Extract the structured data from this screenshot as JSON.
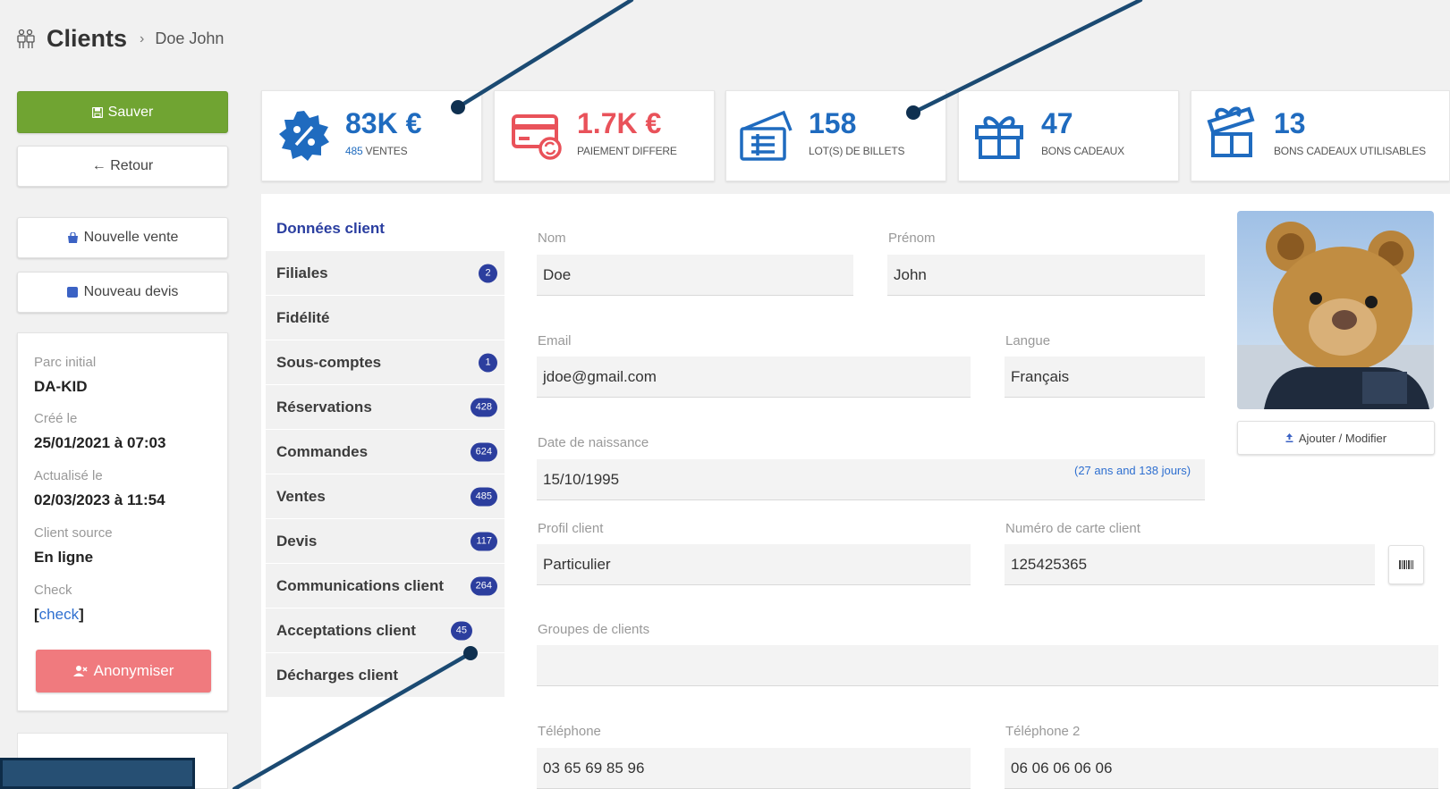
{
  "header": {
    "title": "Clients",
    "breadcrumb": "Doe John"
  },
  "actions": {
    "save": "Sauver",
    "back": "← Retour",
    "new_sale": "Nouvelle vente",
    "new_quote": "Nouveau devis",
    "anonymize": "Anonymiser"
  },
  "client_info": {
    "park_label": "Parc initial",
    "park_value": "DA-KID",
    "created_label": "Créé le",
    "created_value": "25/01/2021 à 07:03",
    "updated_label": "Actualisé le",
    "updated_value": "02/03/2023 à 11:54",
    "source_label": "Client source",
    "source_value": "En ligne",
    "check_label": "Check",
    "check_open": "[",
    "check_link": "check",
    "check_close": "]"
  },
  "stats": [
    {
      "value": "83K €",
      "label_count": "485",
      "label": " VENTES",
      "color": "#1f6bbf",
      "icon": "percent-badge-icon"
    },
    {
      "value": "1.7K €",
      "label": "PAIEMENT DIFFERE",
      "color": "#e9525a",
      "icon": "credit-card-sync-icon"
    },
    {
      "value": "158",
      "label": "LOT(S) DE BILLETS",
      "color": "#1f6bbf",
      "icon": "tickets-icon"
    },
    {
      "value": "47",
      "label": "BONS CADEAUX",
      "color": "#1f6bbf",
      "icon": "gift-icon"
    },
    {
      "value": "13",
      "label": "BONS CADEAUX UTILISABLES",
      "color": "#1f6bbf",
      "icon": "gift-open-icon"
    }
  ],
  "nav": [
    {
      "label": "Données client",
      "active": true
    },
    {
      "label": "Filiales",
      "badge": "2"
    },
    {
      "label": "Fidélité"
    },
    {
      "label": "Sous-comptes",
      "badge": "1"
    },
    {
      "label": "Réservations",
      "badge": "428"
    },
    {
      "label": "Commandes",
      "badge": "624"
    },
    {
      "label": "Ventes",
      "badge": "485"
    },
    {
      "label": "Devis",
      "badge": "117"
    },
    {
      "label": "Communications client",
      "badge": "264"
    },
    {
      "label": "Acceptations client",
      "badge": "45"
    },
    {
      "label": "Décharges client"
    }
  ],
  "form": {
    "nom_label": "Nom",
    "nom_value": "Doe",
    "prenom_label": "Prénom",
    "prenom_value": "John",
    "email_label": "Email",
    "email_value": "jdoe@gmail.com",
    "langue_label": "Langue",
    "langue_value": "Français",
    "dob_label": "Date de naissance",
    "dob_value": "15/10/1995",
    "dob_age": "(27 ans and 138 jours)",
    "profil_label": "Profil client",
    "profil_value": "Particulier",
    "card_label": "Numéro de carte client",
    "card_value": "125425365",
    "groups_label": "Groupes de clients",
    "groups_value": "",
    "phone_label": "Téléphone",
    "phone_value": "03 65 69 85 96",
    "phone2_label": "Téléphone 2",
    "phone2_value": "06 06 06 06 06"
  },
  "photo": {
    "button": "Ajouter / Modifier"
  }
}
